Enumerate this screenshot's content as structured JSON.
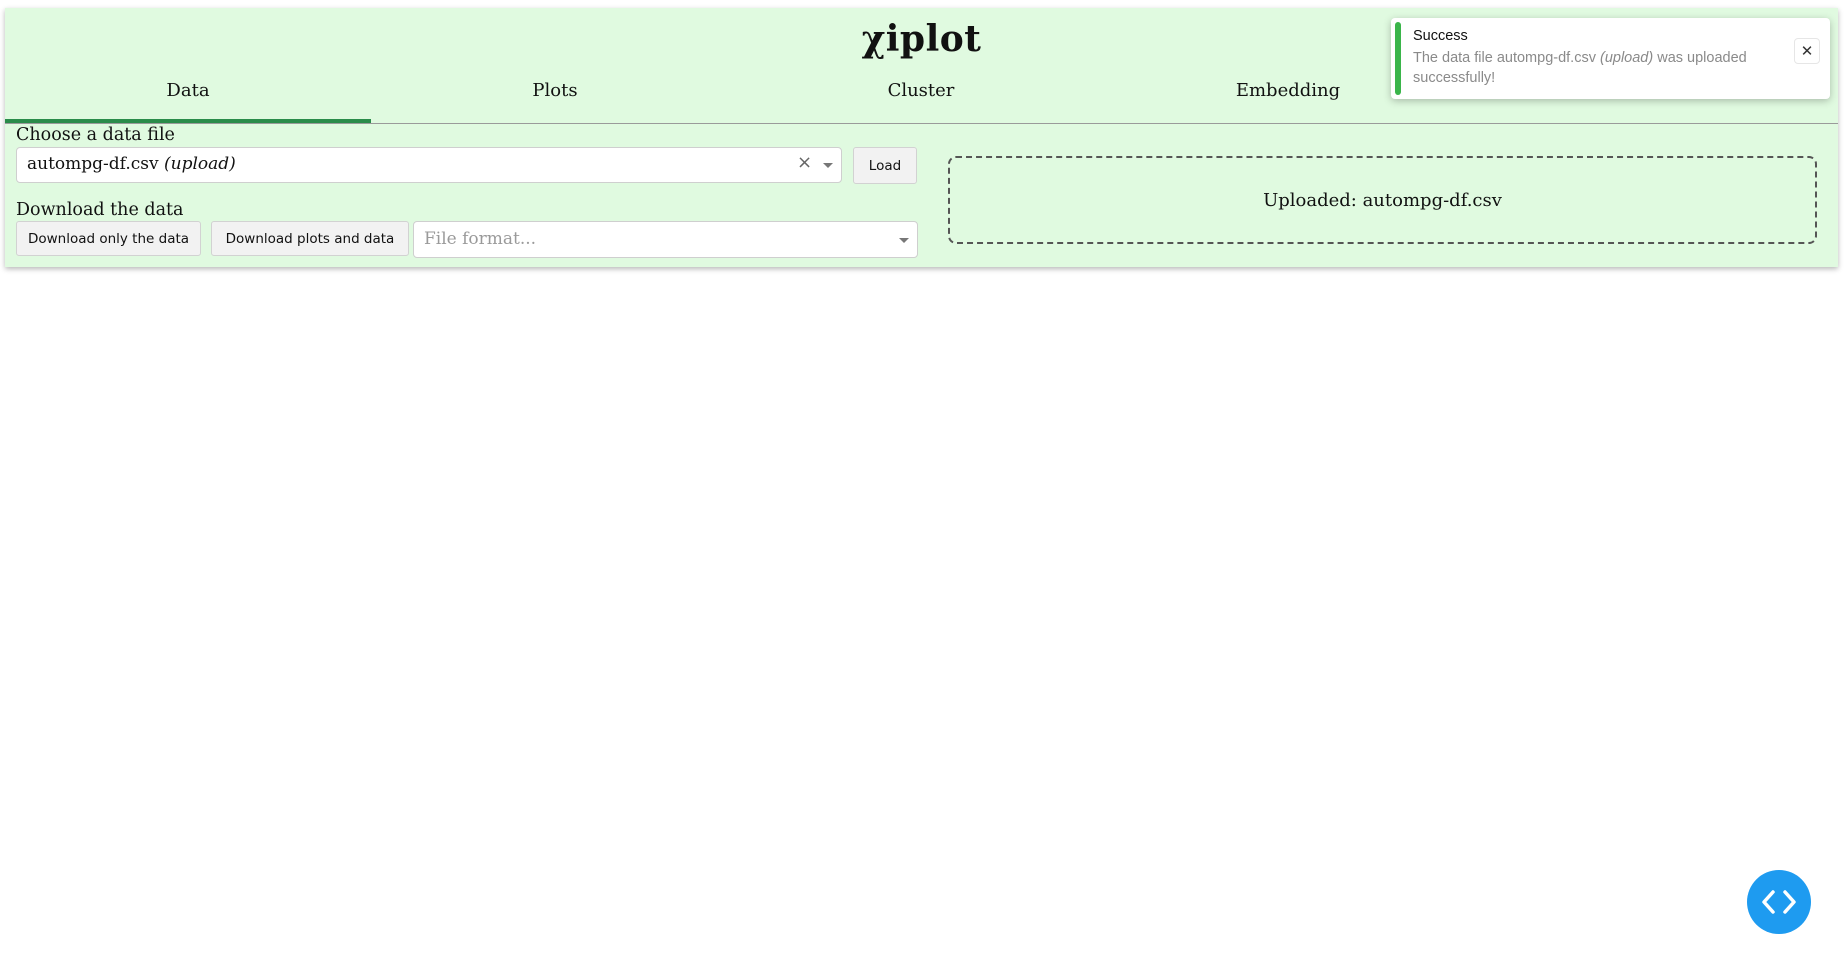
{
  "app": {
    "title": "χiplot"
  },
  "tabs": [
    {
      "label": "Data",
      "active": true
    },
    {
      "label": "Plots",
      "active": false
    },
    {
      "label": "Cluster",
      "active": false
    },
    {
      "label": "Embedding",
      "active": false
    }
  ],
  "data_panel": {
    "choose_label": "Choose a data file",
    "file_select": {
      "value_name": "autompg-df.csv",
      "value_tag": "(upload)"
    },
    "load_label": "Load",
    "download_label": "Download the data",
    "download_data_label": "Download only the data",
    "download_all_label": "Download plots and data",
    "format_placeholder": "File format...",
    "upload_status": "Uploaded: autompg-df.csv"
  },
  "toast": {
    "title": "Success",
    "body_prefix": "The data file autompg-df.csv",
    "body_tag": "(upload)",
    "body_suffix": "was uploaded successfully!"
  },
  "colors": {
    "panel_bg": "#e0fae0",
    "active_tab": "#2a8c4a",
    "toast_accent": "#3ab54a",
    "fab": "#1e9bf0"
  },
  "icons": {
    "clear": "clear-icon",
    "dropdown": "chevron-down-icon",
    "close": "close-icon",
    "code": "code-icon"
  }
}
